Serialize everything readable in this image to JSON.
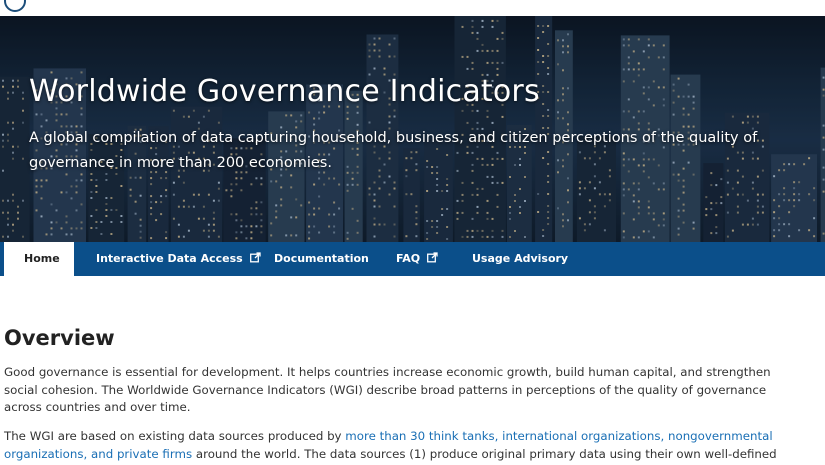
{
  "hero": {
    "title": "Worldwide Governance Indicators",
    "subtitle": "A global compilation of data capturing household, business, and citizen perceptions of the quality of governance in more than 200 economies."
  },
  "nav": {
    "items": [
      {
        "label": "Home",
        "active": true,
        "external": false
      },
      {
        "label": "Interactive Data Access",
        "active": false,
        "external": true
      },
      {
        "label": "Documentation",
        "active": false,
        "external": false
      },
      {
        "label": "FAQ",
        "active": false,
        "external": true
      },
      {
        "label": "Usage Advisory",
        "active": false,
        "external": false
      }
    ]
  },
  "main": {
    "heading": "Overview",
    "p1": "Good governance is essential for development. It helps countries increase economic growth, build human capital, and strengthen social cohesion. The Worldwide Governance Indicators (WGI) describe broad patterns in perceptions of the quality of governance across countries and over time.",
    "p2_before": "The WGI are based on existing data sources produced by ",
    "p2_link": "more than 30 think tanks, international organizations, nongovernmental organizations, and private firms",
    "p2_after": " around the world. The data sources (1) produce original primary data using their own well-defined"
  },
  "colors": {
    "nav_bg": "#0b4f8a",
    "link": "#1a6fb5",
    "text": "#333333"
  },
  "icons": [
    "external-link-icon",
    "logo-icon"
  ]
}
